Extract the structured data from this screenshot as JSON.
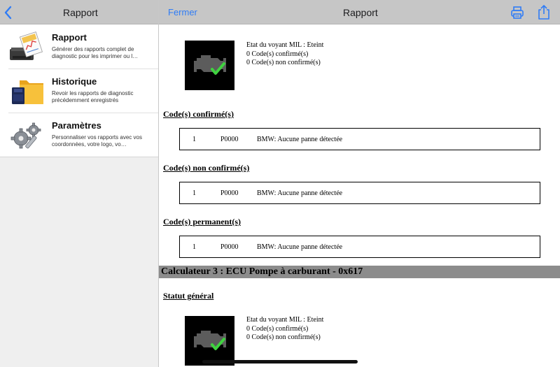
{
  "left_bar": {
    "title": "Rapport"
  },
  "right_bar": {
    "close_label": "Fermer",
    "title": "Rapport"
  },
  "sidebar": {
    "items": [
      {
        "title": "Rapport",
        "description": "Générer des rapports complet de diagnostic pour les imprimer ou l…"
      },
      {
        "title": "Historique",
        "description": "Revoir les rapports de diagnostic précédemment enregistrés"
      },
      {
        "title": "Paramètres",
        "description": "Personnaliser vos rapports avec vos coordonnées, votre logo, vo…"
      }
    ]
  },
  "report": {
    "block1": {
      "mil_status": "Etat du voyant MIL : Eteint",
      "confirmed_count": "0 Code(s) confirmé(s)",
      "unconfirmed_count": "0 Code(s) non confirmé(s)"
    },
    "sections": [
      {
        "title": "Code(s) confirmé(s)",
        "num": "1",
        "code": "P0000",
        "desc": "BMW: Aucune panne détectée"
      },
      {
        "title": "Code(s) non confirmé(s)",
        "num": "1",
        "code": "P0000",
        "desc": "BMW: Aucune panne détectée"
      },
      {
        "title": "Code(s) permanent(s)",
        "num": "1",
        "code": "P0000",
        "desc": "BMW: Aucune panne détectée"
      }
    ],
    "ecu_header": "Calculateur 3 : ECU Pompe à carburant - 0x617",
    "general_status_title": "Statut général",
    "block2": {
      "mil_status": "Etat du voyant MIL : Eteint",
      "confirmed_count": "0 Code(s) confirmé(s)",
      "unconfirmed_count": "0 Code(s) non confirmé(s)"
    }
  },
  "colors": {
    "accent": "#2f7cf6",
    "bar": "#c6c6c6",
    "ecu_header": "#8c8c8c",
    "check": "#3fd23f"
  }
}
